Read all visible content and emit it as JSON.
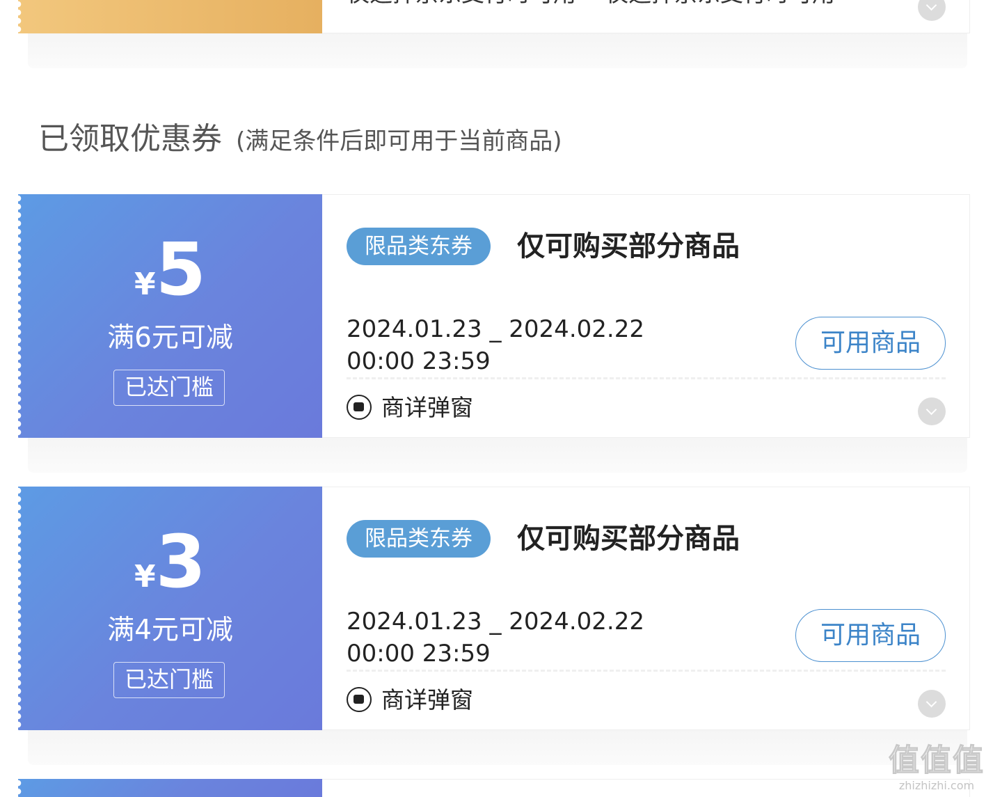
{
  "top_coupon": {
    "condition_text_1": "仅选择京东支付时可用",
    "condition_text_2": "仅选择京东支付时可用"
  },
  "section": {
    "title": "已领取优惠券",
    "subtitle": "(满足条件后即可用于当前商品)"
  },
  "coupons": [
    {
      "currency": "¥",
      "amount": "5",
      "condition": "满6元可减",
      "threshold_badge": "已达门槛",
      "tag": "限品类东券",
      "title": "仅可购买部分商品",
      "date_range": "2024.01.23 _ 2024.02.22",
      "time_range": "00:00 23:59",
      "action_label": "可用商品",
      "channel_label": "商详弹窗"
    },
    {
      "currency": "¥",
      "amount": "3",
      "condition": "满4元可减",
      "threshold_badge": "已达门槛",
      "tag": "限品类东券",
      "title": "仅可购买部分商品",
      "date_range": "2024.01.23 _ 2024.02.22",
      "time_range": "00:00 23:59",
      "action_label": "可用商品",
      "channel_label": "商详弹窗"
    }
  ],
  "watermark": {
    "logo_text": "值值值",
    "site": "zhizhizhi.com"
  },
  "colors": {
    "coupon_blue_start": "#5d9be4",
    "coupon_blue_end": "#6a7adb",
    "coupon_gold": "#e6b060",
    "tag_blue": "#5a9ed6",
    "action_blue": "#3c84c8"
  }
}
